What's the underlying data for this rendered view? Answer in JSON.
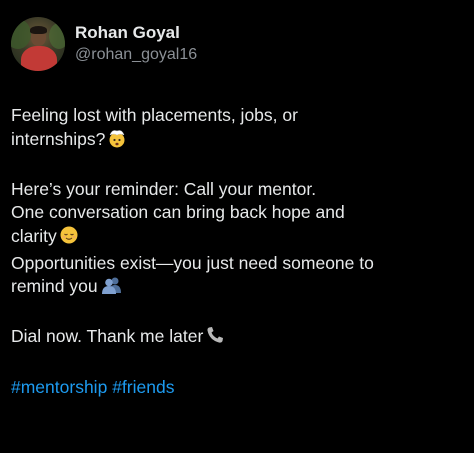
{
  "author": {
    "display_name": "Rohan Goyal",
    "handle": "@rohan_goyal16"
  },
  "post": {
    "line1": "Feeling lost with placements, jobs, or",
    "line2": "internships?",
    "line3": "Here’s your reminder: Call your mentor.",
    "line4": "One conversation can bring back hope and",
    "line5": "clarity",
    "line6": "Opportunities exist—you just need someone to",
    "line7": "remind you",
    "line8": "Dial now. Thank me later",
    "hashtags": [
      "#mentorship",
      "#friends"
    ]
  },
  "icons": {
    "exploding_head": "exploding-head-emoji",
    "relieved_face": "relieved-face-emoji",
    "two_people": "busts-in-silhouette-emoji",
    "telephone": "telephone-receiver-emoji"
  },
  "colors": {
    "background": "#000000",
    "text": "#e7e9ea",
    "secondary": "#8b9096",
    "link": "#1d9bf0"
  }
}
